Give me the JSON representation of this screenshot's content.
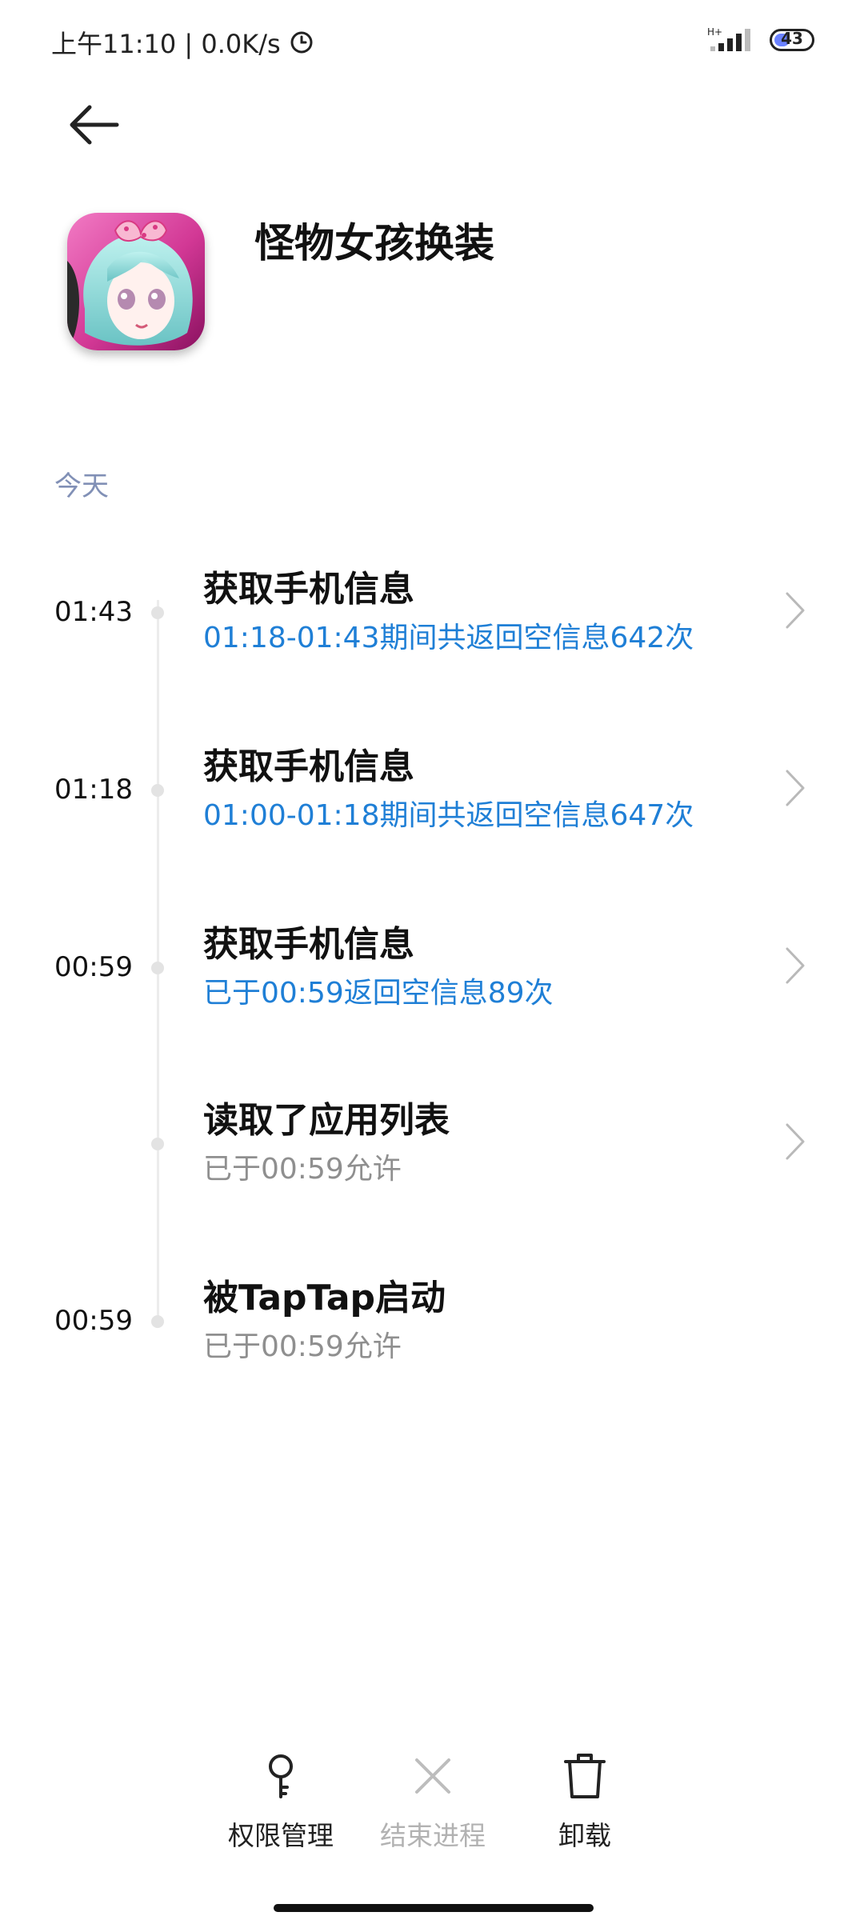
{
  "status_bar": {
    "time_speed": "上午11:10 | 0.0K/s",
    "network": "H+",
    "battery": "43"
  },
  "app": {
    "name": "怪物女孩换装",
    "icon": "anime-girl-app-icon"
  },
  "section": "今天",
  "timeline": [
    {
      "time": "01:43",
      "title": "获取手机信息",
      "subtitle": "01:18-01:43期间共返回空信息642次",
      "subtitle_style": "blue",
      "has_chevron": true
    },
    {
      "time": "01:18",
      "title": "获取手机信息",
      "subtitle": "01:00-01:18期间共返回空信息647次",
      "subtitle_style": "blue",
      "has_chevron": true
    },
    {
      "time": "00:59",
      "title": "获取手机信息",
      "subtitle": "已于00:59返回空信息89次",
      "subtitle_style": "blue",
      "has_chevron": true
    },
    {
      "time": "",
      "title": "读取了应用列表",
      "subtitle": "已于00:59允许",
      "subtitle_style": "grey",
      "has_chevron": true
    },
    {
      "time": "00:59",
      "title": "被TapTap启动",
      "subtitle": "已于00:59允许",
      "subtitle_style": "grey",
      "has_chevron": false
    }
  ],
  "actions": [
    {
      "label": "权限管理",
      "icon": "key-icon",
      "enabled": true
    },
    {
      "label": "结束进程",
      "icon": "close-icon",
      "enabled": false
    },
    {
      "label": "卸载",
      "icon": "trash-icon",
      "enabled": true
    }
  ],
  "colors": {
    "accent_blue": "#1f7fd6",
    "section_label": "#8190b6",
    "muted_grey": "#8f8f8f"
  }
}
